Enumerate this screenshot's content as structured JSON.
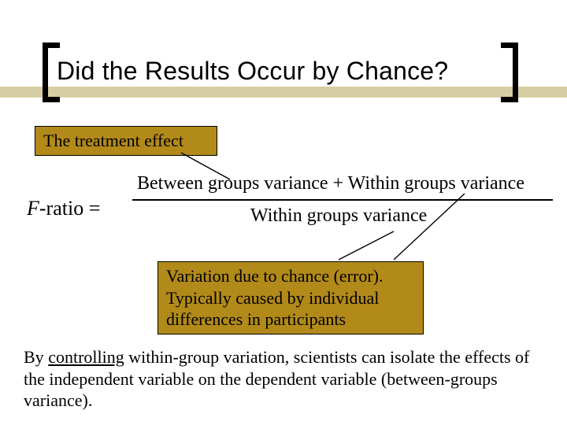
{
  "title": "Did the Results Occur by Chance?",
  "callouts": {
    "treatment": "The treatment effect",
    "chance": "Variation due to chance (error). Typically caused by individual differences in participants"
  },
  "equation": {
    "lhs_symbol": "F",
    "lhs_rest": "-ratio =",
    "numerator": "Between groups variance  +  Within groups variance",
    "denominator": "Within groups variance"
  },
  "footer": {
    "pre": "By ",
    "underlined": "controlling",
    "post": " within-group variation, scientists can isolate the effects of the independent variable on the dependent variable (between-groups variance)."
  }
}
